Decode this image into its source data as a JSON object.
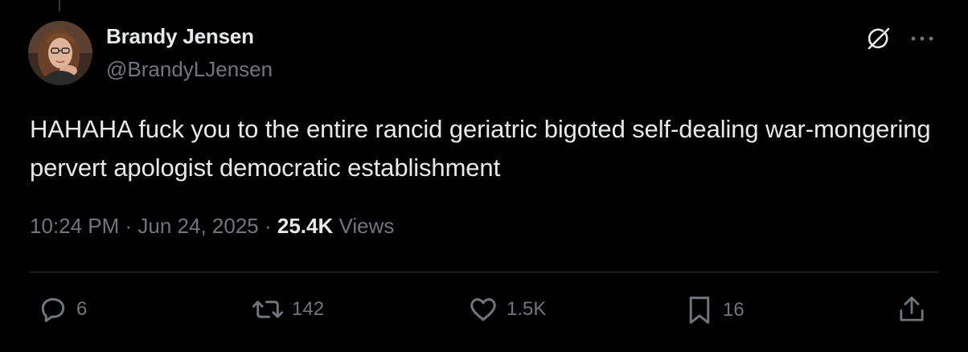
{
  "author": {
    "display_name": "Brandy Jensen",
    "handle": "@BrandyLJensen"
  },
  "tweet": {
    "text": "HAHAHA fuck you to the entire rancid geriatric bigoted self-dealing war-mongering pervert apologist democratic establishment"
  },
  "meta": {
    "time": "10:24 PM",
    "separator": " · ",
    "date": "Jun 24, 2025",
    "views_count": "25.4K",
    "views_label": " Views"
  },
  "actions": {
    "replies": "6",
    "reposts": "142",
    "likes": "1.5K",
    "bookmarks": "16"
  },
  "icons": {
    "grok": "grok-icon",
    "more": "more-icon",
    "reply": "reply-icon",
    "repost": "repost-icon",
    "like": "heart-icon",
    "bookmark": "bookmark-icon",
    "share": "share-icon"
  },
  "colors": {
    "background": "#000000",
    "primary_text": "#e7e9ea",
    "secondary_text": "#71767b",
    "divider": "#2f3336"
  }
}
